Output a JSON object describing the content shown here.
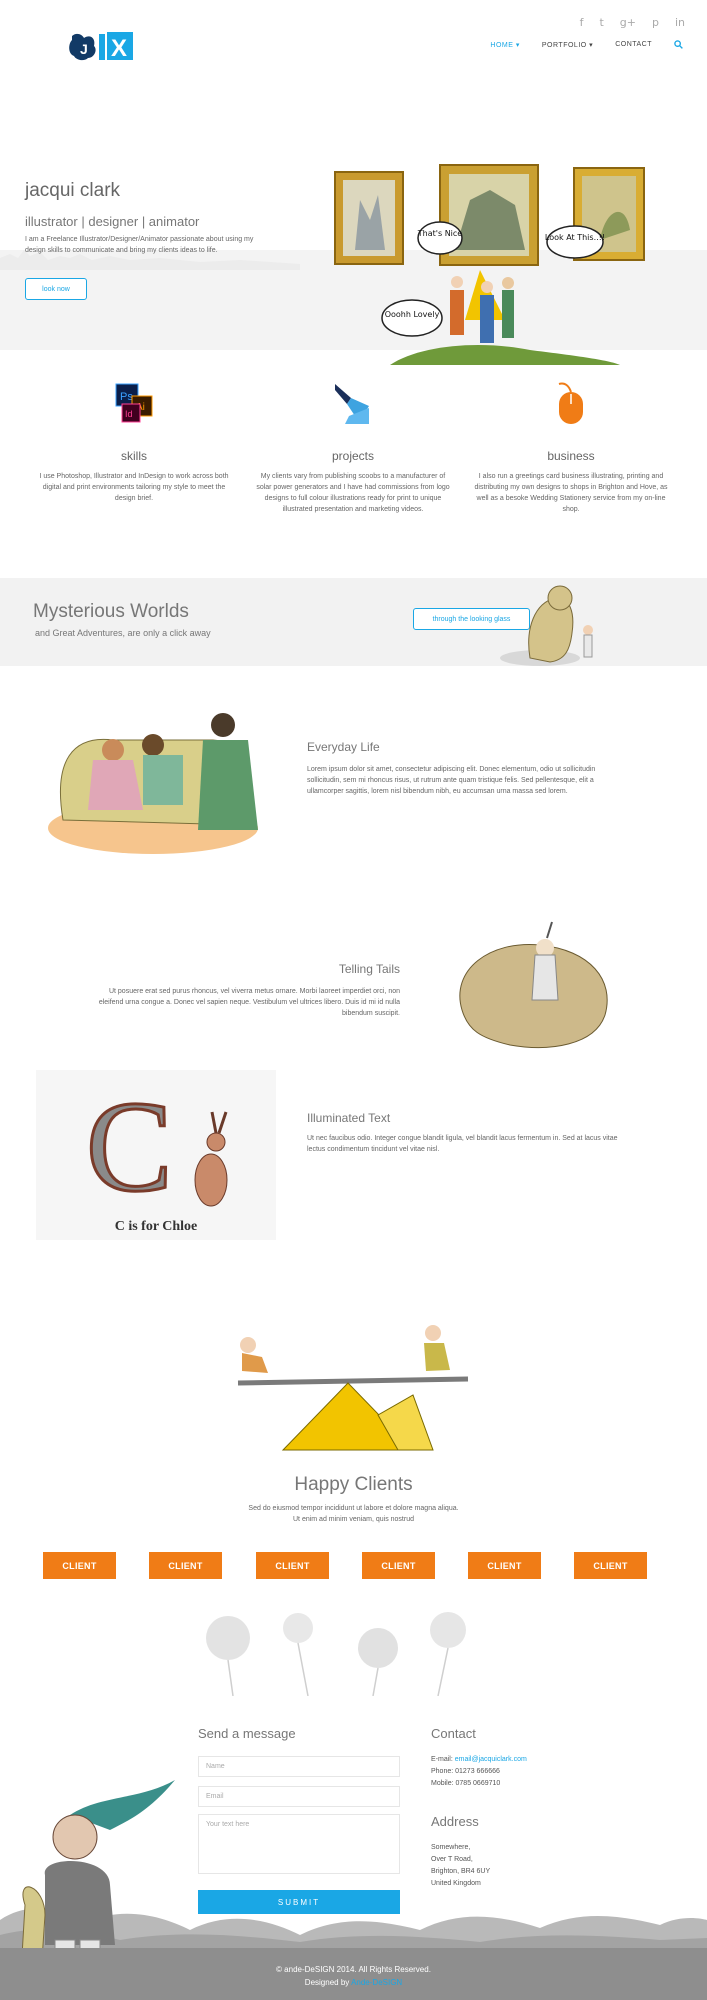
{
  "header": {
    "logo_alt": "JX",
    "social": [
      "f",
      "t",
      "g+",
      "p",
      "in"
    ],
    "nav": [
      {
        "label": "HOME",
        "active": true,
        "caret": "▾"
      },
      {
        "label": "PORTFOLIO",
        "active": false,
        "caret": "▾"
      },
      {
        "label": "CONTACT",
        "active": false,
        "caret": ""
      }
    ],
    "search_icon": "search-icon"
  },
  "hero": {
    "name": "jacqui clark",
    "roles": "illustrator | designer | animator",
    "description": "I am a Freelance Illustrator/Designer/Animator passionate about using my design skills to communicate and bring my clients ideas to life.",
    "button": "look now",
    "bubbles": [
      "That's Nice",
      "Look At This..!!",
      "Ooohh Lovely"
    ]
  },
  "features": [
    {
      "title": "skills",
      "text": "I use Photoshop, Illustrator and InDesign to work across both digital and print environments tailoring my style to meet the design brief."
    },
    {
      "title": "projects",
      "text": "My clients vary from publishing scoobs to a manufacturer of solar power generators and I have had commissions from logo designs to full colour illustrations ready for print to unique illustrated presentation and marketing videos."
    },
    {
      "title": "business",
      "text": "I also run a greetings card business illustrating, printing and distributing my own designs to shops in Brighton and Hove, as well as a besoke Wedding Stationery service from my on-line shop."
    }
  ],
  "banner": {
    "title": "Mysterious Worlds",
    "subtitle": "and Great Adventures, are only a click away",
    "button": "through the looking glass"
  },
  "sections": [
    {
      "title": "Everyday Life",
      "text": "Lorem ipsum dolor sit amet, consectetur adipiscing elit. Donec elementum, odio ut sollicitudin sollicitudin, sem mi rhoncus risus, ut rutrum ante quam tristique felis. Sed pellentesque, elit a ullamcorper sagittis, lorem nisl bibendum nibh, eu accumsan urna massa sed lorem."
    },
    {
      "title": "Telling Tails",
      "text": "Ut posuere erat sed purus rhoncus, vel viverra metus ornare. Morbi laoreet imperdiet orci, non eleifend urna congue a. Donec vel sapien neque. Vestibulum vel ultrices libero. Duis id mi id nulla bibendum suscipit."
    },
    {
      "title": "Illuminated Text",
      "text": "Ut nec faucibus odio. Integer congue blandit ligula, vel blandit lacus fermentum in. Sed at lacus vitae lectus condimentum tincidunt vel vitae nisl.",
      "image_caption": "C is for Chloe"
    }
  ],
  "clients": {
    "title": "Happy Clients",
    "text_line1": "Sed do eiusmod tempor incididunt ut labore et dolore magna aliqua.",
    "text_line2": "Ut enim ad minim veniam, quis nostrud",
    "buttons": [
      "CLIENT",
      "CLIENT",
      "CLIENT",
      "CLIENT",
      "CLIENT",
      "CLIENT"
    ]
  },
  "contact_form": {
    "title": "Send a message",
    "name_placeholder": "Name",
    "email_placeholder": "Email",
    "message_placeholder": "Your text here",
    "submit": "SUBMIT"
  },
  "contact_info": {
    "title": "Contact",
    "email_label": "E-mail: ",
    "email": "email@jacquiclark.com",
    "phone": "Phone: 01273 666666",
    "mobile": "Mobile: 0785 0669710",
    "address_title": "Address",
    "address": [
      "Somewhere,",
      "Over T Road,",
      "Brighton, BR4 6UY",
      "United Kingdom"
    ]
  },
  "footer": {
    "copyright": "© ande-DeSIGN 2014. All Rights Reserved.",
    "designed_by_label": "Designed by ",
    "designed_by": "Ande-DeSIGN"
  },
  "colors": {
    "accent": "#1aa7e5",
    "orange": "#f07c16",
    "footer": "#8e8e8e"
  }
}
